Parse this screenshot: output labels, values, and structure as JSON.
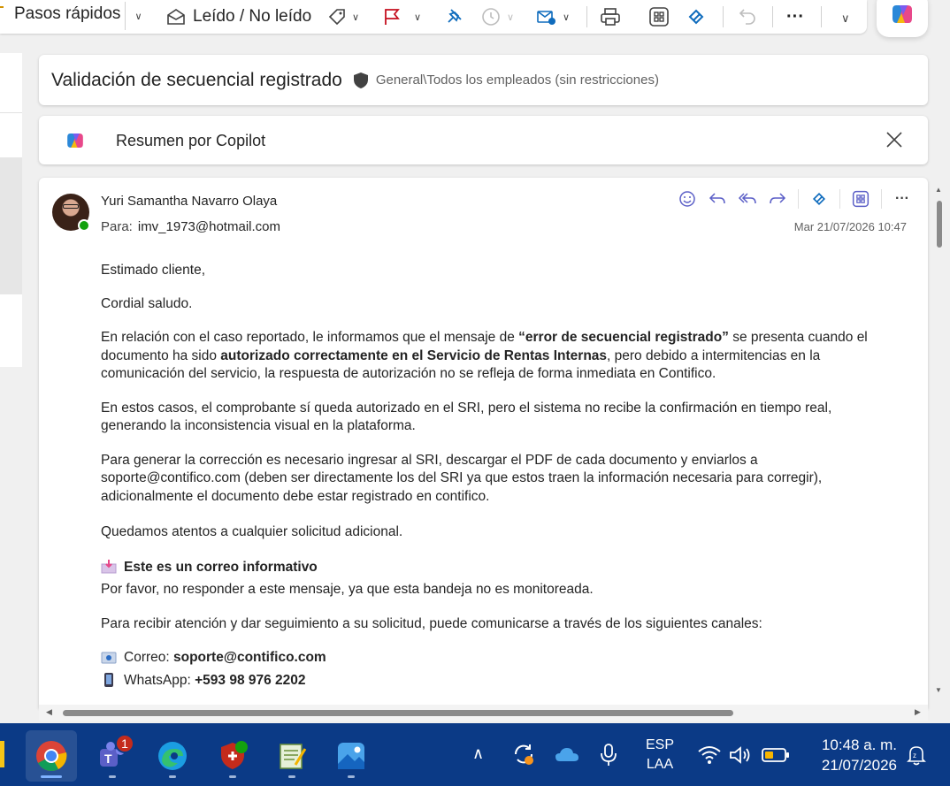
{
  "toolbar": {
    "quick_steps": "Pasos rápidos",
    "read_unread": "Leído / No leído"
  },
  "subject_bar": {
    "subject": "Validación de secuencial registrado",
    "sensitivity": "General\\Todos los empleados (sin restricciones)"
  },
  "copilot": {
    "title": "Resumen por Copilot"
  },
  "message": {
    "sender": "Yuri Samantha Navarro Olaya",
    "to_label": "Para:",
    "to_address": "imv_1973@hotmail.com",
    "date": "Mar 21/07/2026 10:47",
    "greeting": "Estimado cliente,",
    "salutation": "Cordial saludo.",
    "p1_a": "En relación con el caso reportado, le informamos que el mensaje de ",
    "p1_b": "“error de secuencial registrado”",
    "p1_c": " se presenta cuando el documento ha sido ",
    "p1_d": "autorizado correctamente en el Servicio de Rentas Internas",
    "p1_e": ", pero debido a intermitencias en la comunicación del servicio, la respuesta de autorización no se refleja de forma inmediata en Contifico.",
    "p2": "En estos casos, el comprobante sí queda autorizado en el SRI, pero el sistema no recibe la confirmación en tiempo real, generando la inconsistencia visual en la plataforma.",
    "p3": "Para generar la corrección es necesario ingresar al SRI, descargar el PDF de cada documento y enviarlos a soporte@contifico.com (deben ser directamente los del SRI ya que estos traen la información necesaria para corregir), adicionalmente el documento debe estar registrado en contifico.",
    "p4": "Quedamos atentos a cualquier solicitud adicional.",
    "info_title": "Este es un correo informativo",
    "info_text": "Por favor, no responder a este mensaje, ya que esta bandeja no es monitoreada.",
    "channels_intro": "Para recibir atención y dar seguimiento a su solicitud, puede comunicarse a través de los siguientes canales:",
    "email_label": "Correo: ",
    "email_value": "soporte@contifico.com",
    "whatsapp_label": "WhatsApp: ",
    "whatsapp_value": "+593 98 976 2202"
  },
  "taskbar": {
    "teams_badge": "1",
    "lang_line1": "ESP",
    "lang_line2": "LAA",
    "time": "10:48 a. m.",
    "date": "21/07/2026"
  },
  "colors": {
    "accent": "#0f6cbd",
    "flag": "#c50f1f",
    "taskbar": "#0b3a86"
  }
}
